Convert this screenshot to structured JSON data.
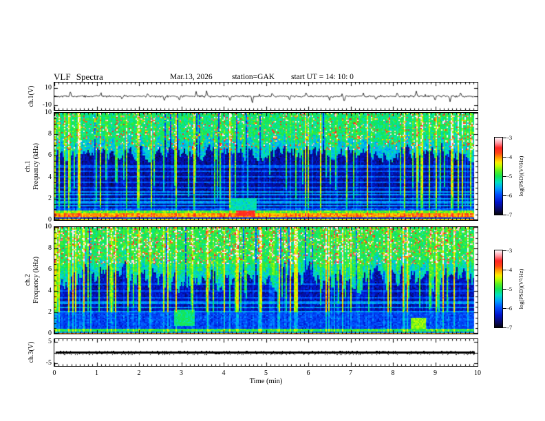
{
  "header": {
    "title": "VLF Spectra",
    "date": "Mar.13, 2026",
    "station": "station=GAK",
    "start_ut": "start UT =  14: 10: 0"
  },
  "x_axis": {
    "label": "Time  (min)",
    "unit": "min",
    "range": [
      0,
      10
    ],
    "ticks": [
      0,
      1,
      2,
      3,
      4,
      5,
      6,
      7,
      8,
      9,
      10
    ],
    "minor_tick_step": 0.1
  },
  "colorbar": {
    "label": "log(PSD)(V²/Hz)",
    "range": [
      -7,
      -3
    ],
    "ticks": [
      -3,
      -4,
      -5,
      -6,
      -7
    ]
  },
  "panels": {
    "wave": {
      "label": "ch.1(V)",
      "y_ticks": [
        10,
        -10
      ]
    },
    "spec1": {
      "label_ch": "ch.1",
      "label_axis": "Frequency (kHz)",
      "y_ticks": [
        10,
        8,
        6,
        4,
        2,
        0
      ]
    },
    "spec2": {
      "label_ch": "ch.2",
      "label_axis": "Frequency (kHz)",
      "y_ticks": [
        10,
        8,
        6,
        4,
        2,
        0
      ]
    },
    "ch3": {
      "label": "ch.3(V)",
      "y_ticks": [
        5,
        -5
      ]
    }
  },
  "chart_data": [
    {
      "type": "line",
      "name": "ch1-waveform",
      "x_range_min": [
        0,
        10
      ],
      "y_range_V": [
        -10,
        10
      ],
      "baseline_V": 0,
      "noise_amplitude_V": 1.2,
      "description": "Continuous noisy broadband trace centered on 0 V with narrow impulsive sferic spikes",
      "spikes": [
        {
          "t": 0.38,
          "v": 6
        },
        {
          "t": 1.1,
          "v": 5
        },
        {
          "t": 1.6,
          "v": -4
        },
        {
          "t": 2.2,
          "v": 4
        },
        {
          "t": 2.6,
          "v": -5
        },
        {
          "t": 2.95,
          "v": -6
        },
        {
          "t": 3.35,
          "v": 5
        },
        {
          "t": 3.6,
          "v": 7
        },
        {
          "t": 4.15,
          "v": -5
        },
        {
          "t": 4.68,
          "v": -8
        },
        {
          "t": 5.15,
          "v": 4
        },
        {
          "t": 5.55,
          "v": -4
        },
        {
          "t": 5.95,
          "v": 5
        },
        {
          "t": 6.5,
          "v": -5
        },
        {
          "t": 6.85,
          "v": -7
        },
        {
          "t": 7.3,
          "v": 4
        },
        {
          "t": 7.6,
          "v": -4
        },
        {
          "t": 8.1,
          "v": 5
        },
        {
          "t": 8.55,
          "v": 6
        },
        {
          "t": 9.0,
          "v": -5
        },
        {
          "t": 9.35,
          "v": -6
        },
        {
          "t": 9.6,
          "v": 4
        }
      ]
    },
    {
      "type": "heatmap",
      "name": "ch1-spectrogram",
      "x_range_min": [
        0,
        10
      ],
      "y_range_khz": [
        0,
        10
      ],
      "z_range_log_psd": [
        -7,
        -3
      ],
      "description": "Green/yellow band above ~6 kHz with red sferic streaks, dark blue 1.5-6 kHz region cut by vertical sferic lines and cyan harmonic rows, intense orange/red band near 0.3-0.6 kHz",
      "top_level": -5.15,
      "dark_level": -6.62,
      "boundary_base_khz": 6.2,
      "boundary_var_khz": 1.4,
      "strong_sferic_fraction": 0.11,
      "red_speckle_chance": 0.07,
      "harmonic_lines_khz": [
        1.0,
        1.33,
        1.67,
        2.0,
        2.33,
        2.67,
        3.0,
        3.5,
        4.0,
        4.5,
        5.0
      ],
      "low_bands": [
        {
          "f_range": [
            0.95,
            1.15
          ],
          "level": -6.0
        },
        {
          "f_range": [
            0.6,
            0.95
          ],
          "level": -4.8
        },
        {
          "f_range": [
            0.32,
            0.6
          ],
          "level": -4.1
        },
        {
          "f_range": [
            0.18,
            0.32
          ],
          "level": -6.3
        },
        {
          "f_range": [
            0.05,
            0.18
          ],
          "level": -4.4
        },
        {
          "f_range": [
            0.0,
            0.05
          ],
          "level": -6.8
        }
      ],
      "events": [
        {
          "t": 4.5,
          "f_range": [
            0.35,
            0.85
          ],
          "level": -3.6,
          "width_min": 0.22
        },
        {
          "t": 4.45,
          "f_range": [
            0.9,
            2.1
          ],
          "level": -5.3,
          "width_min": 0.3
        }
      ]
    },
    {
      "type": "heatmap",
      "name": "ch2-spectrogram",
      "x_range_min": [
        0,
        10
      ],
      "y_range_khz": [
        0,
        10
      ],
      "z_range_log_psd": [
        -7,
        -3
      ],
      "description": "Dense green/yellow/red vertical sferic streaks reaching deep below 5 kHz, dark background, blocky blue/cyan region 0.5-2 kHz, thin yellow-green band near 0.3 kHz and red line at bottom edge",
      "top_level": -5.05,
      "dark_level": -6.55,
      "boundary_base_khz": 5.2,
      "boundary_var_khz": 2.3,
      "strong_sferic_fraction": 0.13,
      "red_speckle_chance": 0.12,
      "harmonic_lines_khz": [
        0.8,
        1.2,
        1.6,
        2.0,
        2.4,
        2.9,
        3.4,
        4.0,
        4.7
      ],
      "low_bands": [
        {
          "f_range": [
            0.5,
            2.0
          ],
          "level": -6.1
        },
        {
          "f_range": [
            0.25,
            0.5
          ],
          "level": -5.0
        },
        {
          "f_range": [
            0.1,
            0.25
          ],
          "level": -5.8
        },
        {
          "f_range": [
            0.0,
            0.1
          ],
          "level": -4.2
        }
      ],
      "events": [
        {
          "t": 3.05,
          "f_range": [
            0.7,
            2.3
          ],
          "level": -5.1,
          "width_min": 0.25
        },
        {
          "t": 8.6,
          "f_range": [
            0.5,
            1.5
          ],
          "level": -4.6,
          "width_min": 0.18
        }
      ]
    },
    {
      "type": "line",
      "name": "ch3-waveform",
      "x_range_min": [
        0,
        10
      ],
      "y_range_V": [
        -5,
        5
      ],
      "constant_value_V": 0,
      "trace_thickness_V": 0.4,
      "description": "Flat saturated thick black trace at 0 V across the full record"
    }
  ]
}
